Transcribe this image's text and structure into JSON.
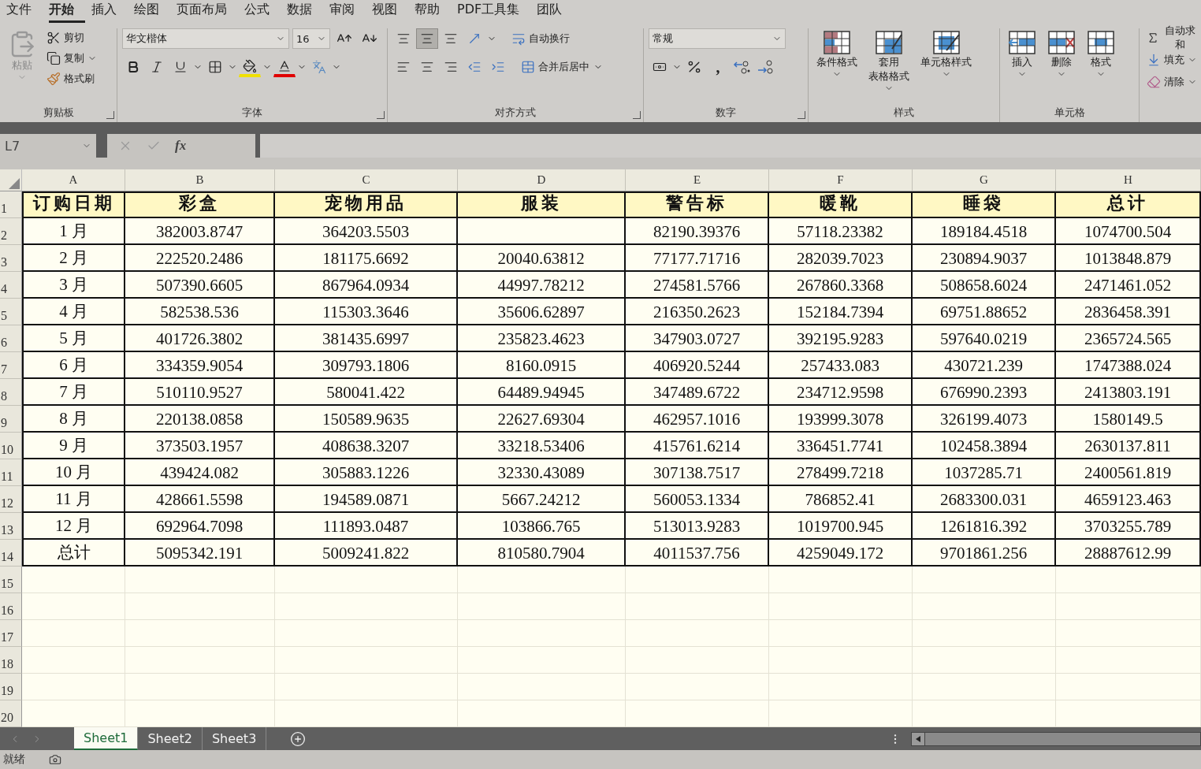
{
  "menu_tabs": [
    {
      "label": "文件",
      "selected": false
    },
    {
      "label": "开始",
      "selected": true
    },
    {
      "label": "插入",
      "selected": false
    },
    {
      "label": "绘图",
      "selected": false
    },
    {
      "label": "页面布局",
      "selected": false
    },
    {
      "label": "公式",
      "selected": false
    },
    {
      "label": "数据",
      "selected": false
    },
    {
      "label": "审阅",
      "selected": false
    },
    {
      "label": "视图",
      "selected": false
    },
    {
      "label": "帮助",
      "selected": false
    },
    {
      "label": "PDF工具集",
      "selected": false
    },
    {
      "label": "团队",
      "selected": false
    }
  ],
  "clipboard": {
    "paste": "粘贴",
    "cut": "剪切",
    "copy": "复制",
    "format_painter": "格式刷",
    "label": "剪贴板"
  },
  "font": {
    "font_name": "华文楷体",
    "font_size": "16",
    "label": "字体"
  },
  "alignment": {
    "vertical_align": [
      {
        "selected": false
      },
      {
        "selected": true
      },
      {
        "selected": false
      }
    ],
    "wrap_text": "自动换行",
    "merge": "合并后居中",
    "label": "对齐方式"
  },
  "number": {
    "format": "常规",
    "comma": ",",
    "label": "数字"
  },
  "styles": {
    "buttons": [
      {
        "lines": [
          "条件格式"
        ]
      },
      {
        "lines": [
          "套用",
          "表格格式"
        ]
      },
      {
        "lines": [
          "单元格样式"
        ]
      }
    ],
    "label": "样式"
  },
  "cells": {
    "buttons": [
      {
        "label": "插入"
      },
      {
        "label": "删除"
      },
      {
        "label": "格式"
      }
    ],
    "label": "单元格"
  },
  "editing": {
    "items": [
      "自动求和",
      "填充",
      "清除"
    ]
  },
  "formula_bar": {
    "name_box": "L7",
    "fx": "fx"
  },
  "columns": [
    "A",
    "B",
    "C",
    "D",
    "E",
    "F",
    "G",
    "H"
  ],
  "rows": [
    {
      "number": "1",
      "kind": "header",
      "cells": [
        "订购日期",
        "彩盒",
        "宠物用品",
        "服装",
        "警告标",
        "暖靴",
        "睡袋",
        "总计"
      ]
    },
    {
      "number": "2",
      "kind": "data",
      "cells": [
        "1 月",
        "382003.8747",
        "364203.5503",
        null,
        "82190.39376",
        "57118.23382",
        "189184.4518",
        "1074700.504"
      ]
    },
    {
      "number": "3",
      "kind": "data",
      "cells": [
        "2 月",
        "222520.2486",
        "181175.6692",
        "20040.63812",
        "77177.71716",
        "282039.7023",
        "230894.9037",
        "1013848.879"
      ]
    },
    {
      "number": "4",
      "kind": "data",
      "cells": [
        "3 月",
        "507390.6605",
        "867964.0934",
        "44997.78212",
        "274581.5766",
        "267860.3368",
        "508658.6024",
        "2471461.052"
      ]
    },
    {
      "number": "5",
      "kind": "data",
      "cells": [
        "4 月",
        "582538.536",
        "115303.3646",
        "35606.62897",
        "216350.2623",
        "152184.7394",
        "69751.88652",
        "2836458.391"
      ]
    },
    {
      "number": "6",
      "kind": "data",
      "cells": [
        "5 月",
        "401726.3802",
        "381435.6997",
        "235823.4623",
        "347903.0727",
        "392195.9283",
        "597640.0219",
        "2365724.565"
      ]
    },
    {
      "number": "7",
      "kind": "data",
      "cells": [
        "6 月",
        "334359.9054",
        "309793.1806",
        "8160.0915",
        "406920.5244",
        "257433.083",
        "430721.239",
        "1747388.024"
      ]
    },
    {
      "number": "8",
      "kind": "data",
      "cells": [
        "7 月",
        "510110.9527",
        "580041.422",
        "64489.94945",
        "347489.6722",
        "234712.9598",
        "676990.2393",
        "2413803.191"
      ]
    },
    {
      "number": "9",
      "kind": "data",
      "cells": [
        "8 月",
        "220138.0858",
        "150589.9635",
        "22627.69304",
        "462957.1016",
        "193999.3078",
        "326199.4073",
        "1580149.5"
      ]
    },
    {
      "number": "10",
      "kind": "data",
      "cells": [
        "9 月",
        "373503.1957",
        "408638.3207",
        "33218.53406",
        "415761.6214",
        "336451.7741",
        "102458.3894",
        "2630137.811"
      ]
    },
    {
      "number": "11",
      "kind": "data",
      "cells": [
        "10 月",
        "439424.082",
        "305883.1226",
        "32330.43089",
        "307138.7517",
        "278499.7218",
        "1037285.71",
        "2400561.819"
      ]
    },
    {
      "number": "12",
      "kind": "data",
      "cells": [
        "11 月",
        "428661.5598",
        "194589.0871",
        "5667.24212",
        "560053.1334",
        "786852.41",
        "2683300.031",
        "4659123.463"
      ]
    },
    {
      "number": "13",
      "kind": "data",
      "cells": [
        "12 月",
        "692964.7098",
        "111893.0487",
        "103866.765",
        "513013.9283",
        "1019700.945",
        "1261816.392",
        "3703255.789"
      ]
    },
    {
      "number": "14",
      "kind": "data",
      "cells": [
        "总计",
        "5095342.191",
        "5009241.822",
        "810580.7904",
        "4011537.756",
        "4259049.172",
        "9701861.256",
        "28887612.99"
      ]
    }
  ],
  "empty_rows": [
    "15",
    "16",
    "17",
    "18",
    "19",
    "20"
  ],
  "sheet_tabs": [
    {
      "label": "Sheet1",
      "selected": true
    },
    {
      "label": "Sheet2",
      "selected": false
    },
    {
      "label": "Sheet3",
      "selected": false
    }
  ],
  "status": "就绪"
}
